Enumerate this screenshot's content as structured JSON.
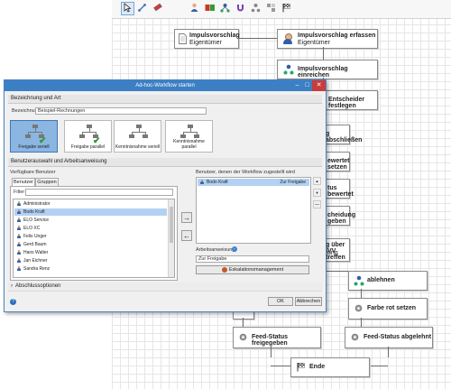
{
  "toolbar": {
    "icons": [
      "pointer-icon",
      "connector-icon",
      "eraser-icon",
      "user-node-icon",
      "approval-node-icon",
      "split-node-icon",
      "magnet-icon",
      "script-node-icon",
      "gateway-node-icon",
      "end-flag-icon"
    ]
  },
  "workflow": {
    "start_node": {
      "title": "Impulsvorschlag",
      "subtitle": "Eigentümer"
    },
    "nodes": [
      {
        "title": "Impulsvorschlag erfassen",
        "subtitle": "Eigentümer"
      },
      {
        "title": "Impulsvorschlag einreichen"
      },
      {
        "title": "Entscheider festlegen"
      },
      {
        "title": "g abschließen"
      },
      {
        "title": "ewertet setzen"
      },
      {
        "title": "tus bewertet"
      },
      {
        "title": "cheidung geben"
      },
      {
        "title": "g über IVV treffen",
        "subtitle": "tung"
      },
      {
        "title": "ablehnen"
      },
      {
        "title": "Farbe rot setzen"
      },
      {
        "title": "Feed-Status freigegeben"
      },
      {
        "title": "Feed-Status abgelehnt"
      },
      {
        "title": "Ende"
      }
    ]
  },
  "dialog": {
    "title": "Ad-hoc-Workflow starten",
    "section_name": "Bezeichnung und Art",
    "name_label": "Bezeichnung",
    "name_value": "Beispiel-Rechnungen",
    "types": [
      {
        "label": "Freigabe seriell",
        "selected": true
      },
      {
        "label": "Freigabe parallel",
        "selected": false
      },
      {
        "label": "Kenntnisnahme seriell",
        "selected": false
      },
      {
        "label": "Kenntnisnahme parallel",
        "selected": false
      }
    ],
    "section_users": "Benutzerauswahl und Arbeitsanweisung",
    "available_label": "Verfügbare Benutzer",
    "tab_users": "Benutzer",
    "tab_groups": "Gruppen",
    "filter_label": "Filter",
    "filter_value": "",
    "available_users": [
      "Administrator",
      "Bodo Kraft",
      "ELO Service",
      "ELO XC",
      "Felix Unger",
      "Gerd Baum",
      "Hans Walter",
      "Jan Eichner",
      "Sandra Renz"
    ],
    "selected_index": 1,
    "assigned_label": "Benutzer, denen der Workflow zugestellt wird",
    "assigned": [
      {
        "name": "Bodo Kraft",
        "note": "Zur Freigabe"
      }
    ],
    "instruction_label": "Arbeitsanweisung",
    "instruction_value": "Zur Freigabe",
    "escalation_label": "Eskalationsmanagement",
    "completion_options": "Abschlussoptionen",
    "ok": "OK",
    "cancel": "Abbrechen",
    "move_right": "→",
    "move_left": "←",
    "up": "▲",
    "down": "▼",
    "remove": "—"
  }
}
